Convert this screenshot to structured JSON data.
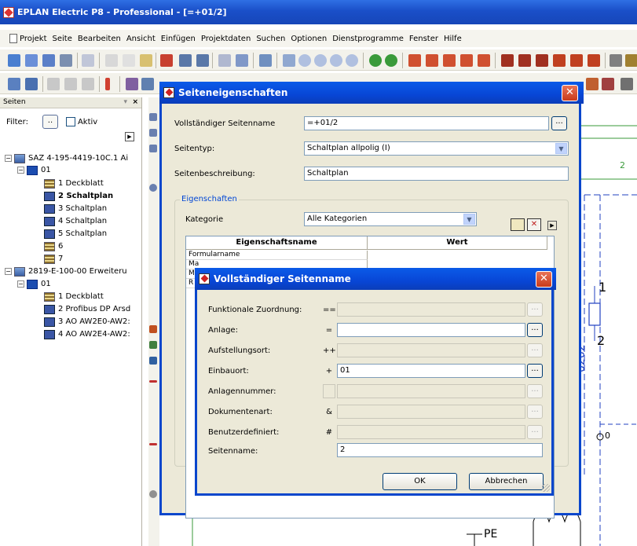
{
  "app": {
    "title": "EPLAN Electric P8 - Professional - [=+01/2]"
  },
  "menu": [
    "Projekt",
    "Seite",
    "Bearbeiten",
    "Ansicht",
    "Einfügen",
    "Projektdaten",
    "Suchen",
    "Optionen",
    "Dienstprogramme",
    "Fenster",
    "Hilfe"
  ],
  "panel": {
    "title": "Seiten",
    "filter_label": "Filter:",
    "filter_button": "..",
    "active_label": "Aktiv",
    "tree": [
      {
        "label": "SAZ 4-195-4419-10C.1 Ai",
        "level": 0,
        "icon": "project-icon"
      },
      {
        "label": "01",
        "level": 1,
        "icon": "structure-icon"
      },
      {
        "label": "1 Deckblatt",
        "level": 2,
        "icon": "cover-page-icon"
      },
      {
        "label": "2 Schaltplan",
        "level": 2,
        "icon": "schematic-page-icon",
        "selected": true
      },
      {
        "label": "3 Schaltplan",
        "level": 2,
        "icon": "schematic-page-icon"
      },
      {
        "label": "4 Schaltplan",
        "level": 2,
        "icon": "schematic-page-icon"
      },
      {
        "label": "5 Schaltplan",
        "level": 2,
        "icon": "schematic-page-icon"
      },
      {
        "label": "6",
        "level": 2,
        "icon": "cover-page-icon"
      },
      {
        "label": "7",
        "level": 2,
        "icon": "cover-page-icon"
      },
      {
        "label": "2819-E-100-00 Erweiteru",
        "level": 0,
        "icon": "project-icon"
      },
      {
        "label": "01",
        "level": 1,
        "icon": "structure-icon"
      },
      {
        "label": "1 Deckblatt",
        "level": 2,
        "icon": "cover-page-icon"
      },
      {
        "label": "2 Profibus DP Arsd",
        "level": 2,
        "icon": "schematic-page-icon"
      },
      {
        "label": "3 AO AW2E0-AW2:",
        "level": 2,
        "icon": "schematic-page-icon"
      },
      {
        "label": "4 AO AW2E4-AW2:",
        "level": 2,
        "icon": "schematic-page-icon"
      }
    ]
  },
  "canvas": {
    "col_num": "2",
    "terminal_top": "1",
    "terminal_bottom": "2",
    "device_label": "0202",
    "node_label": "0",
    "pe_label": "PE"
  },
  "page_props": {
    "title": "Seiteneigenschaften",
    "full_name_label": "Vollständiger Seitenname",
    "full_name_value": "=+01/2",
    "type_label": "Seitentyp:",
    "type_value": "Schaltplan allpolig (I)",
    "desc_label": "Seitenbeschreibung:",
    "desc_value": "Schaltplan",
    "group_title": "Eigenschaften",
    "category_label": "Kategorie",
    "category_value": "Alle Kategorien",
    "col_name": "Eigenschaftsname",
    "col_value": "Wert",
    "rows": [
      {
        "name": "Formularname",
        "value": ""
      },
      {
        "name": "Ma",
        "value": ""
      },
      {
        "name": "M",
        "value": ""
      },
      {
        "name": "R",
        "value": ""
      }
    ]
  },
  "full_name_dialog": {
    "title": "Vollständiger Seitenname",
    "fields": [
      {
        "label": "Funktionale Zuordnung:",
        "prefix": "==",
        "value": "",
        "disabled": true
      },
      {
        "label": "Anlage:",
        "prefix": "=",
        "value": "",
        "disabled": false
      },
      {
        "label": "Aufstellungsort:",
        "prefix": "++",
        "value": "",
        "disabled": true
      },
      {
        "label": "Einbauort:",
        "prefix": "+",
        "value": "01",
        "disabled": false
      },
      {
        "label": "Anlagennummer:",
        "prefix": "",
        "value": "",
        "disabled": true
      },
      {
        "label": "Dokumentenart:",
        "prefix": "&",
        "value": "",
        "disabled": true
      },
      {
        "label": "Benutzerdefiniert:",
        "prefix": "#",
        "value": "",
        "disabled": true
      }
    ],
    "page_name_label": "Seitenname:",
    "page_name_value": "2",
    "ok_label": "OK",
    "cancel_label": "Abbrechen"
  }
}
